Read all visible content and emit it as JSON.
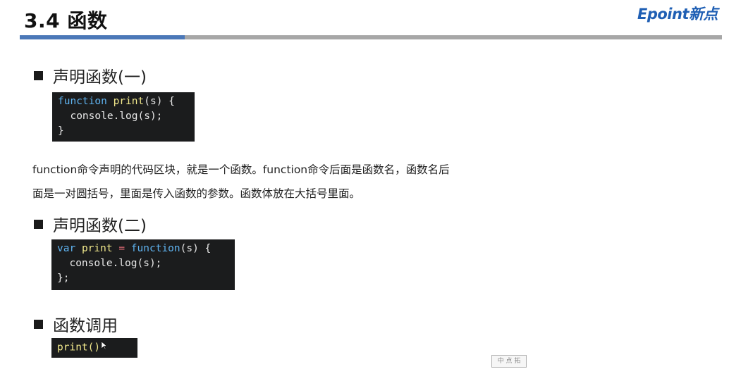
{
  "slide": {
    "title": "3.4 函数",
    "logo": "Epoint新点"
  },
  "sections": [
    {
      "heading": "声明函数(一)",
      "code": {
        "line1": {
          "kw": "function",
          "name": "print",
          "args": "(s) {"
        },
        "line2": "  console.log(s);",
        "line3": "}"
      }
    },
    {
      "heading": "声明函数(二)",
      "code": {
        "line1": {
          "kw": "var",
          "name": "print",
          "op": "=",
          "kw2": "function",
          "args": "(s) {"
        },
        "line2": "  console.log(s);",
        "line3": "};"
      }
    },
    {
      "heading": "函数调用",
      "code": {
        "line1": "print()"
      }
    }
  ],
  "paragraph": {
    "line1": "function命令声明的代码区块，就是一个函数。function命令后面是函数名，函数名后",
    "line2": "面是一对圆括号，里面是传入函数的参数。函数体放在大括号里面。"
  },
  "footer": {
    "mark": "中 点 拓"
  },
  "colors": {
    "accent_blue": "#4b78b8",
    "header_gray": "#a7a7a7",
    "code_bg": "#1b1c1d",
    "keyword": "#5fb3f0",
    "function_name": "#f2e98c",
    "operator": "#e06c75",
    "logo": "#1f5fb4"
  }
}
